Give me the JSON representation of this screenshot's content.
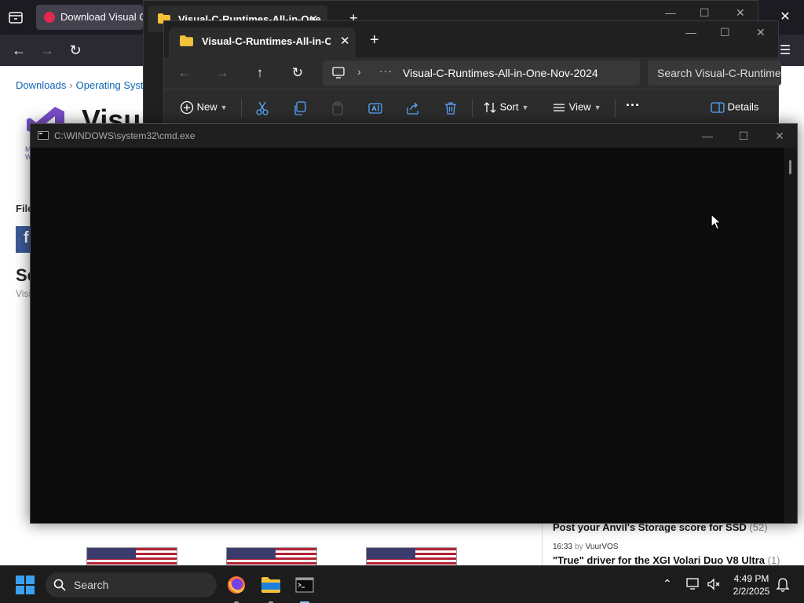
{
  "browser": {
    "tab_label": "Download Visual C++",
    "close_label": "✕",
    "nav": {
      "back": "←",
      "forward": "→",
      "reload": "↻",
      "menu": "☰"
    }
  },
  "page": {
    "breadcrumbs": [
      "Downloads",
      "Operating Syste"
    ],
    "logo_title": "Visu",
    "small_text": [
      "M",
      "W"
    ],
    "files_label": "File",
    "facebook_label": "f",
    "section_heading": "Se",
    "section_sub": "Visi",
    "news": [
      {
        "title": "Post your Anvil's Storage score for SSD",
        "count": "(52)"
      },
      {
        "time": "16:33",
        "by": "by",
        "author": "VuurVOS",
        "title": "\"True\" driver for the XGI Volari Duo V8 Ultra",
        "count": "(1)"
      }
    ]
  },
  "explorer_back": {
    "tab_label": "Visual-C-Runtimes-All-in-One",
    "close": "✕",
    "new_tab": "+",
    "controls": [
      "—",
      "☐",
      "✕"
    ]
  },
  "explorer": {
    "tab_label": "Visual-C-Runtimes-All-in-One-",
    "close": "✕",
    "new_tab": "+",
    "controls": [
      "—",
      "☐",
      "✕"
    ],
    "nav": {
      "back": "←",
      "forward": "→",
      "up": "↑",
      "refresh": "↻"
    },
    "address": {
      "chevron": "›",
      "overflow": "···",
      "path": "Visual-C-Runtimes-All-in-One-Nov-2024"
    },
    "search_placeholder": "Search Visual-C-Runtimes",
    "toolbar": {
      "new": "New",
      "sort": "Sort",
      "view": "View",
      "more": "···",
      "details": "Details"
    }
  },
  "cmd": {
    "title": "C:\\WINDOWS\\system32\\cmd.exe",
    "controls": [
      "—",
      "☐",
      "✕"
    ]
  },
  "taskbar": {
    "search_label": "Search",
    "time": "4:49 PM",
    "date": "2/2/2025",
    "tray_chevron": "⌃"
  },
  "colors": {
    "cmd_background": "#0c0c0c",
    "explorer_background": "#202020",
    "taskbar_background": "#1c1c1c",
    "windows_blue": "#3aa0f0"
  }
}
